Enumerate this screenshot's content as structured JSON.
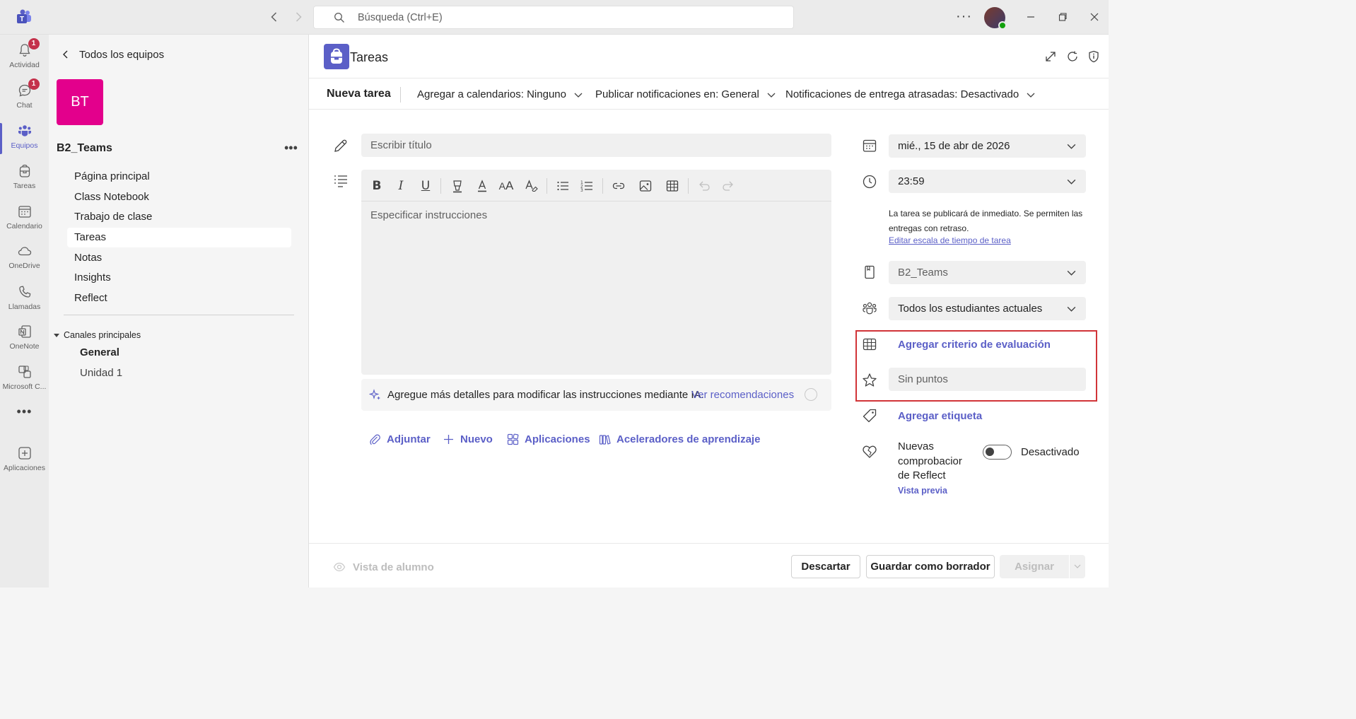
{
  "search": {
    "placeholder": "Búsqueda (Ctrl+E)"
  },
  "rail": {
    "items": [
      {
        "label": "Actividad",
        "icon": "bell-icon",
        "badge": "1"
      },
      {
        "label": "Chat",
        "icon": "chat-icon",
        "badge": "1"
      },
      {
        "label": "Equipos",
        "icon": "teams-icon",
        "active": true
      },
      {
        "label": "Tareas",
        "icon": "backpack-icon"
      },
      {
        "label": "Calendario",
        "icon": "calendar-icon"
      },
      {
        "label": "OneDrive",
        "icon": "cloud-icon"
      },
      {
        "label": "Llamadas",
        "icon": "phone-icon"
      },
      {
        "label": "OneNote",
        "icon": "onenote-icon"
      },
      {
        "label": "Microsoft C...",
        "icon": "copilot-icon"
      },
      {
        "label": "Aplicaciones",
        "icon": "add-apps-icon"
      }
    ],
    "more": "•••"
  },
  "team": {
    "back_label": "Todos los equipos",
    "initials": "BT",
    "tile_color": "#e3008c",
    "name": "B2_Teams",
    "more": "•••",
    "nav": [
      "Página principal",
      "Class Notebook",
      "Trabajo de clase",
      "Tareas",
      "Notas",
      "Insights",
      "Reflect"
    ],
    "selected_nav": "Tareas",
    "channels_header": "Canales principales",
    "channels": [
      "General",
      "Unidad 1"
    ]
  },
  "app": {
    "title": "Tareas",
    "accent": "#5b5fc7"
  },
  "cmdbar": {
    "title": "Nueva tarea",
    "add_calendar": "Agregar a calendarios: Ninguno",
    "publish_notifications": "Publicar notificaciones en: General",
    "late_notifications": "Notificaciones de entrega atrasadas: Desactivado"
  },
  "form": {
    "title_placeholder": "Escribir título",
    "instructions_placeholder": "Especificar instrucciones",
    "ai_hint": "Agregue más detalles para modificar las instrucciones mediante IA.",
    "ai_link": "Ver recomendaciones",
    "actions": {
      "attach": "Adjuntar",
      "new": "Nuevo",
      "apps": "Aplicaciones",
      "accelerators": "Aceleradores de aprendizaje"
    }
  },
  "details": {
    "due_date": "mié., 15 de abr de 2026",
    "due_time": "23:59",
    "schedule_note": "La tarea se publicará de inmediato. Se permiten las entregas con retraso.",
    "edit_schedule_link": "Editar escala de tiempo de tarea",
    "class": "B2_Teams",
    "students": "Todos los estudiantes actuales",
    "add_rubric": "Agregar criterio de evaluación",
    "points_placeholder": "Sin puntos",
    "add_tag": "Agregar etiqueta",
    "reflect_label": "Nuevas comprobacior de Reflect",
    "reflect_state": "Desactivado",
    "reflect_preview": "Vista previa"
  },
  "footer": {
    "student_view": "Vista de alumno",
    "discard": "Descartar",
    "save_draft": "Guardar como borrador",
    "assign": "Asignar"
  }
}
